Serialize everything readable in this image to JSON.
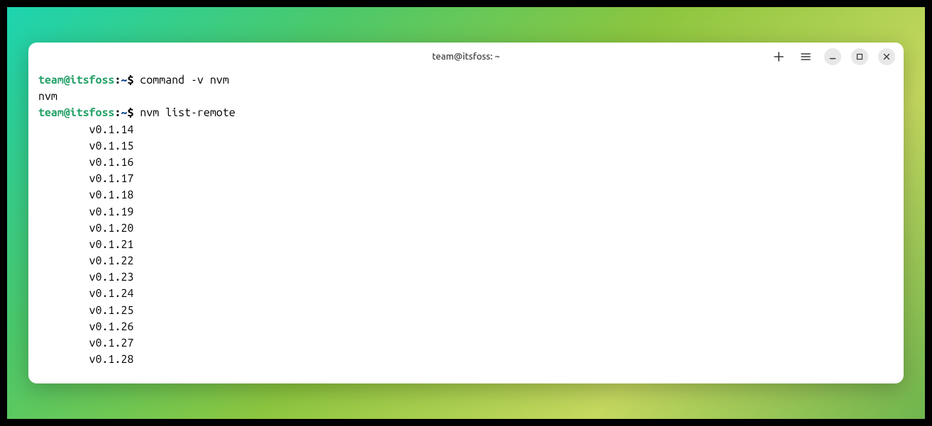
{
  "window": {
    "title": "team@itsfoss: ~"
  },
  "prompt1": {
    "userhost": "team@itsfoss",
    "colon": ":",
    "path": "~",
    "dollar": "$ ",
    "command": "command -v nvm"
  },
  "output1": "nvm",
  "prompt2": {
    "userhost": "team@itsfoss",
    "colon": ":",
    "path": "~",
    "dollar": "$ ",
    "command": "nvm list-remote"
  },
  "versions": [
    "        v0.1.14",
    "        v0.1.15",
    "        v0.1.16",
    "        v0.1.17",
    "        v0.1.18",
    "        v0.1.19",
    "        v0.1.20",
    "        v0.1.21",
    "        v0.1.22",
    "        v0.1.23",
    "        v0.1.24",
    "        v0.1.25",
    "        v0.1.26",
    "        v0.1.27",
    "        v0.1.28"
  ]
}
